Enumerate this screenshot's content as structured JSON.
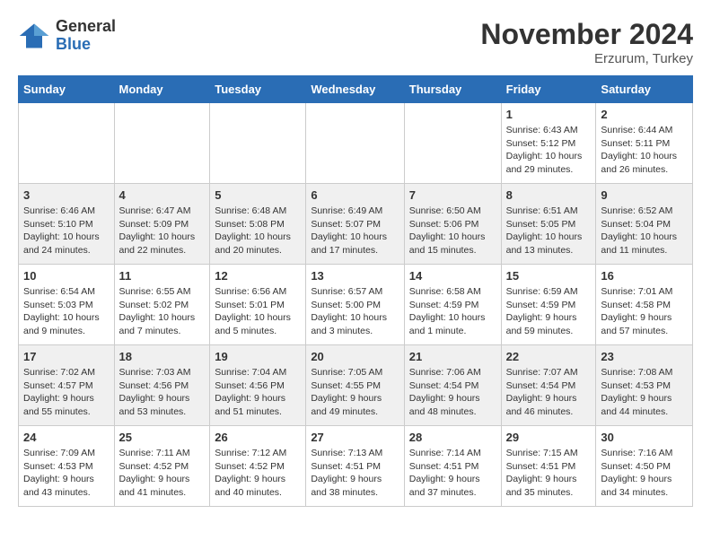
{
  "header": {
    "logo": {
      "general": "General",
      "blue": "Blue"
    },
    "title": "November 2024",
    "location": "Erzurum, Turkey"
  },
  "weekdays": [
    "Sunday",
    "Monday",
    "Tuesday",
    "Wednesday",
    "Thursday",
    "Friday",
    "Saturday"
  ],
  "weeks": [
    [
      {
        "day": "",
        "info": ""
      },
      {
        "day": "",
        "info": ""
      },
      {
        "day": "",
        "info": ""
      },
      {
        "day": "",
        "info": ""
      },
      {
        "day": "",
        "info": ""
      },
      {
        "day": "1",
        "info": "Sunrise: 6:43 AM\nSunset: 5:12 PM\nDaylight: 10 hours and 29 minutes."
      },
      {
        "day": "2",
        "info": "Sunrise: 6:44 AM\nSunset: 5:11 PM\nDaylight: 10 hours and 26 minutes."
      }
    ],
    [
      {
        "day": "3",
        "info": "Sunrise: 6:46 AM\nSunset: 5:10 PM\nDaylight: 10 hours and 24 minutes."
      },
      {
        "day": "4",
        "info": "Sunrise: 6:47 AM\nSunset: 5:09 PM\nDaylight: 10 hours and 22 minutes."
      },
      {
        "day": "5",
        "info": "Sunrise: 6:48 AM\nSunset: 5:08 PM\nDaylight: 10 hours and 20 minutes."
      },
      {
        "day": "6",
        "info": "Sunrise: 6:49 AM\nSunset: 5:07 PM\nDaylight: 10 hours and 17 minutes."
      },
      {
        "day": "7",
        "info": "Sunrise: 6:50 AM\nSunset: 5:06 PM\nDaylight: 10 hours and 15 minutes."
      },
      {
        "day": "8",
        "info": "Sunrise: 6:51 AM\nSunset: 5:05 PM\nDaylight: 10 hours and 13 minutes."
      },
      {
        "day": "9",
        "info": "Sunrise: 6:52 AM\nSunset: 5:04 PM\nDaylight: 10 hours and 11 minutes."
      }
    ],
    [
      {
        "day": "10",
        "info": "Sunrise: 6:54 AM\nSunset: 5:03 PM\nDaylight: 10 hours and 9 minutes."
      },
      {
        "day": "11",
        "info": "Sunrise: 6:55 AM\nSunset: 5:02 PM\nDaylight: 10 hours and 7 minutes."
      },
      {
        "day": "12",
        "info": "Sunrise: 6:56 AM\nSunset: 5:01 PM\nDaylight: 10 hours and 5 minutes."
      },
      {
        "day": "13",
        "info": "Sunrise: 6:57 AM\nSunset: 5:00 PM\nDaylight: 10 hours and 3 minutes."
      },
      {
        "day": "14",
        "info": "Sunrise: 6:58 AM\nSunset: 4:59 PM\nDaylight: 10 hours and 1 minute."
      },
      {
        "day": "15",
        "info": "Sunrise: 6:59 AM\nSunset: 4:59 PM\nDaylight: 9 hours and 59 minutes."
      },
      {
        "day": "16",
        "info": "Sunrise: 7:01 AM\nSunset: 4:58 PM\nDaylight: 9 hours and 57 minutes."
      }
    ],
    [
      {
        "day": "17",
        "info": "Sunrise: 7:02 AM\nSunset: 4:57 PM\nDaylight: 9 hours and 55 minutes."
      },
      {
        "day": "18",
        "info": "Sunrise: 7:03 AM\nSunset: 4:56 PM\nDaylight: 9 hours and 53 minutes."
      },
      {
        "day": "19",
        "info": "Sunrise: 7:04 AM\nSunset: 4:56 PM\nDaylight: 9 hours and 51 minutes."
      },
      {
        "day": "20",
        "info": "Sunrise: 7:05 AM\nSunset: 4:55 PM\nDaylight: 9 hours and 49 minutes."
      },
      {
        "day": "21",
        "info": "Sunrise: 7:06 AM\nSunset: 4:54 PM\nDaylight: 9 hours and 48 minutes."
      },
      {
        "day": "22",
        "info": "Sunrise: 7:07 AM\nSunset: 4:54 PM\nDaylight: 9 hours and 46 minutes."
      },
      {
        "day": "23",
        "info": "Sunrise: 7:08 AM\nSunset: 4:53 PM\nDaylight: 9 hours and 44 minutes."
      }
    ],
    [
      {
        "day": "24",
        "info": "Sunrise: 7:09 AM\nSunset: 4:53 PM\nDaylight: 9 hours and 43 minutes."
      },
      {
        "day": "25",
        "info": "Sunrise: 7:11 AM\nSunset: 4:52 PM\nDaylight: 9 hours and 41 minutes."
      },
      {
        "day": "26",
        "info": "Sunrise: 7:12 AM\nSunset: 4:52 PM\nDaylight: 9 hours and 40 minutes."
      },
      {
        "day": "27",
        "info": "Sunrise: 7:13 AM\nSunset: 4:51 PM\nDaylight: 9 hours and 38 minutes."
      },
      {
        "day": "28",
        "info": "Sunrise: 7:14 AM\nSunset: 4:51 PM\nDaylight: 9 hours and 37 minutes."
      },
      {
        "day": "29",
        "info": "Sunrise: 7:15 AM\nSunset: 4:51 PM\nDaylight: 9 hours and 35 minutes."
      },
      {
        "day": "30",
        "info": "Sunrise: 7:16 AM\nSunset: 4:50 PM\nDaylight: 9 hours and 34 minutes."
      }
    ]
  ]
}
